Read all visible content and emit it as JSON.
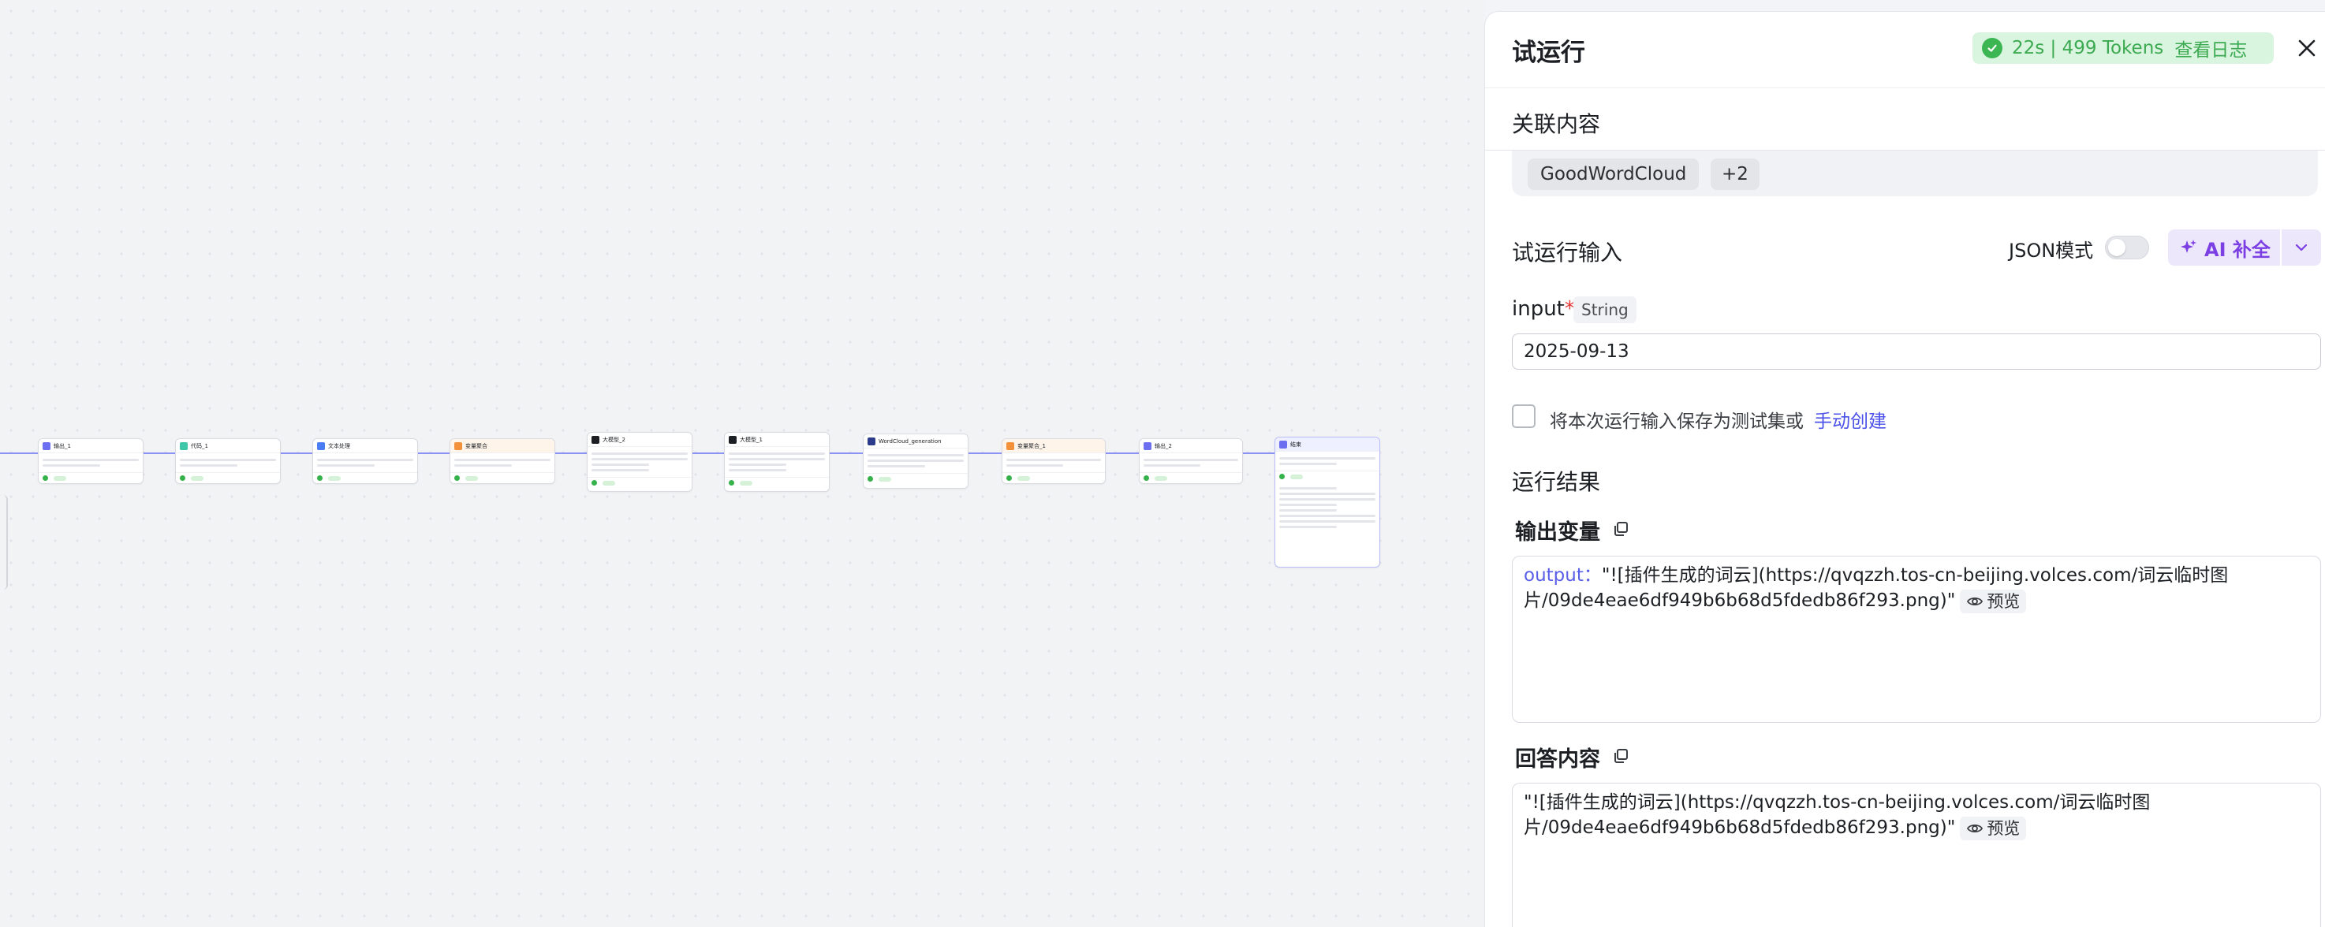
{
  "canvas": {
    "nodes": [
      {
        "title": "输出_1"
      },
      {
        "title": "代码_1"
      },
      {
        "title": "文本处理"
      },
      {
        "title": "变量聚合"
      },
      {
        "title": "大模型_2"
      },
      {
        "title": "大模型_1"
      },
      {
        "title": "WordCloud_generation"
      },
      {
        "title": "变量聚合_1"
      },
      {
        "title": "输出_2"
      },
      {
        "title": "结束"
      }
    ]
  },
  "panel": {
    "title": "试运行",
    "status": {
      "summary": "22s | 499 Tokens",
      "log_link": "查看日志",
      "color": "#3cb652"
    },
    "associated": {
      "title": "关联内容",
      "tags": [
        "GoodWordCloud",
        "+2"
      ]
    },
    "trial_input": {
      "title": "试运行输入",
      "json_mode_label": "JSON模式",
      "ai_button_label": "AI 补全",
      "field": {
        "name": "input",
        "required_mark": "*",
        "type": "String",
        "value": "2025-09-13"
      },
      "save_checkbox_label": "将本次运行输入保存为测试集或",
      "manual_create_link": "手动创建"
    },
    "result": {
      "title": "运行结果",
      "output_vars": {
        "title": "输出变量",
        "key": "output",
        "separator": "：",
        "line1": "\"![插件生成的词云](https://qvqzzh.tos-cn-beijing.volces.com/词云临时图",
        "line2": "片/09de4eae6df949b6b68d5fdedb86f293.png)\"",
        "preview_label": "预览"
      },
      "answer": {
        "title": "回答内容",
        "line1": "\"![插件生成的词云](https://qvqzzh.tos-cn-beijing.volces.com/词云临时图",
        "line2": "片/09de4eae6df949b6b68d5fdedb86f293.png)\"",
        "preview_label": "预览"
      }
    },
    "accent": "#4d53e8"
  }
}
